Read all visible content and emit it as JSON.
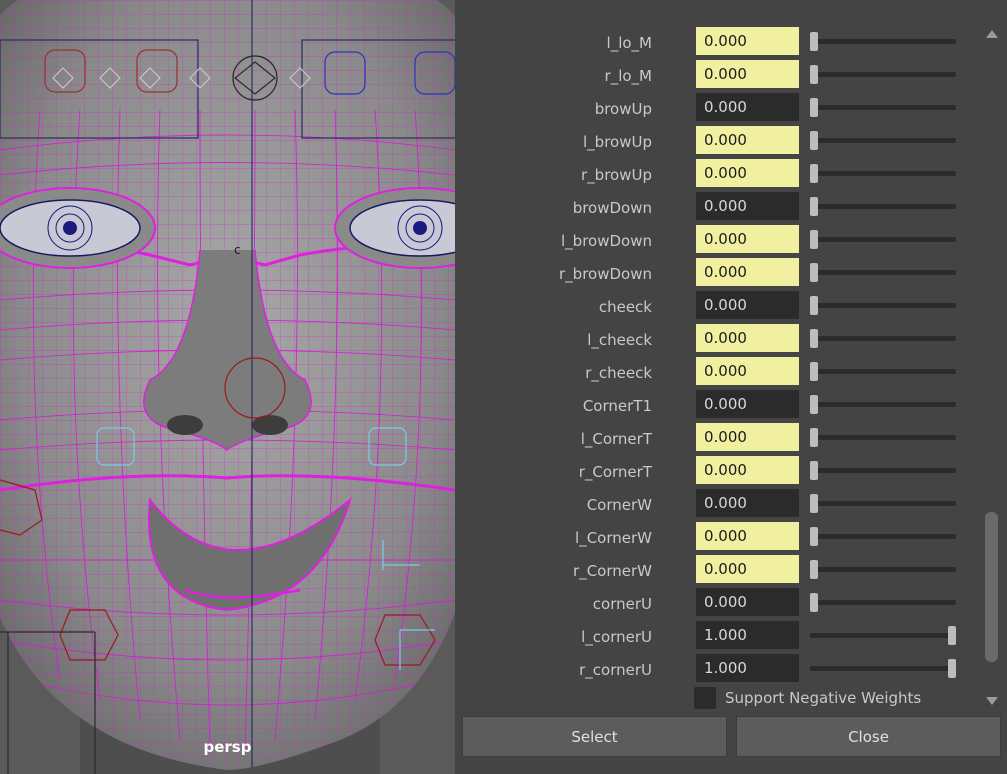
{
  "viewport": {
    "camera_label": "persp"
  },
  "attributes": [
    {
      "name": "l_lo_M",
      "value": "0.000",
      "keyed": true,
      "slider": 0
    },
    {
      "name": "r_lo_M",
      "value": "0.000",
      "keyed": true,
      "slider": 0
    },
    {
      "name": "browUp",
      "value": "0.000",
      "keyed": false,
      "slider": 0
    },
    {
      "name": "l_browUp",
      "value": "0.000",
      "keyed": true,
      "slider": 0
    },
    {
      "name": "r_browUp",
      "value": "0.000",
      "keyed": true,
      "slider": 0
    },
    {
      "name": "browDown",
      "value": "0.000",
      "keyed": false,
      "slider": 0
    },
    {
      "name": "l_browDown",
      "value": "0.000",
      "keyed": true,
      "slider": 0
    },
    {
      "name": "r_browDown",
      "value": "0.000",
      "keyed": true,
      "slider": 0
    },
    {
      "name": "cheeck",
      "value": "0.000",
      "keyed": false,
      "slider": 0
    },
    {
      "name": "l_cheeck",
      "value": "0.000",
      "keyed": true,
      "slider": 0
    },
    {
      "name": "r_cheeck",
      "value": "0.000",
      "keyed": true,
      "slider": 0
    },
    {
      "name": "CornerT1",
      "value": "0.000",
      "keyed": false,
      "slider": 0
    },
    {
      "name": "l_CornerT",
      "value": "0.000",
      "keyed": true,
      "slider": 0
    },
    {
      "name": "r_CornerT",
      "value": "0.000",
      "keyed": true,
      "slider": 0
    },
    {
      "name": "CornerW",
      "value": "0.000",
      "keyed": false,
      "slider": 0
    },
    {
      "name": "l_CornerW",
      "value": "0.000",
      "keyed": true,
      "slider": 0
    },
    {
      "name": "r_CornerW",
      "value": "0.000",
      "keyed": true,
      "slider": 0
    },
    {
      "name": "cornerU",
      "value": "0.000",
      "keyed": false,
      "slider": 0
    },
    {
      "name": "l_cornerU",
      "value": "1.000",
      "keyed": false,
      "slider": 1
    },
    {
      "name": "r_cornerU",
      "value": "1.000",
      "keyed": false,
      "slider": 1
    }
  ],
  "support_negative_weights": {
    "label": "Support Negative Weights",
    "checked": false
  },
  "buttons": {
    "select": "Select",
    "close": "Close"
  },
  "colors": {
    "keyed_field": "#f0f0a0",
    "plain_field": "#2b2b2b",
    "wireframe": "#e020e0",
    "panel_bg": "#444444"
  }
}
